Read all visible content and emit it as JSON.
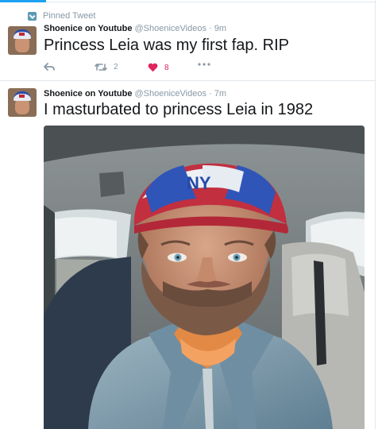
{
  "pinned": {
    "label": "Pinned Tweet",
    "icon": "pin-icon"
  },
  "tweets": [
    {
      "author": {
        "name": "Shoenice on Youtube",
        "handle": "@ShoeniceVideos",
        "separator": "·",
        "time": "9m"
      },
      "text": "Princess Leia was my first fap. RIP",
      "actions": {
        "retweets": "2",
        "likes": "8",
        "liked": true
      }
    },
    {
      "author": {
        "name": "Shoenice on Youtube",
        "handle": "@ShoeniceVideos",
        "separator": "·",
        "time": "7m"
      },
      "text": "I masturbated to princess Leia in 1982",
      "media": {
        "cap_text": "NY"
      }
    }
  ],
  "colors": {
    "accent": "#1da1f2",
    "like": "#e0245e",
    "muted": "#8899a6",
    "text": "#14171a",
    "cap_blue": "#274aa6",
    "cap_red": "#c0283a"
  }
}
